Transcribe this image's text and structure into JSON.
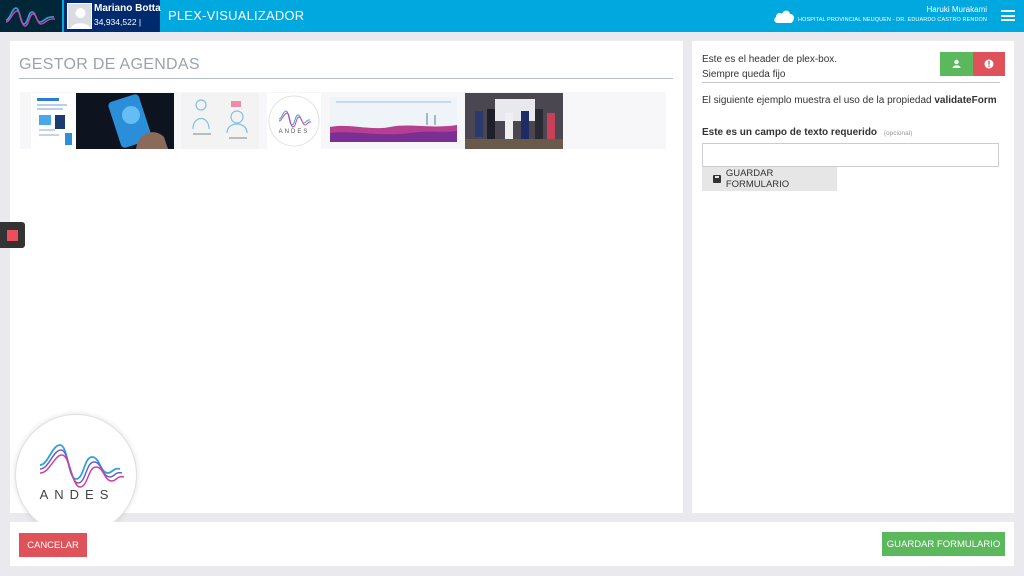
{
  "header": {
    "user_name": "Mariano Botta",
    "user_document": "34,934,522 |",
    "app_title": "PLEX-VISUALIZADOR",
    "right_user": "Haruki Murakami",
    "hospital": "HOSPITAL PROVINCIAL NEUQUEN - DR. EDUARDO CASTRO RENDON",
    "icons": [
      "andes-logo-icon",
      "avatar-icon",
      "cloud-icon",
      "menu-icon"
    ]
  },
  "main": {
    "section_title": "GESTOR DE AGENDAS",
    "gallery_logo_text": "ANDES",
    "big_logo_text": "ANDES"
  },
  "side_panel": {
    "header_line1": "Este es el header de plex-box.",
    "header_line2": "Siempre queda fijo",
    "example_text": "El siguiente ejemplo muestra el uso de la propiedad",
    "example_prop": "validateForm",
    "field_label": "Este es un campo de texto requerido",
    "field_optional": "(opcional)",
    "field_value": "",
    "save_label": "GUARDAR FORMULARIO"
  },
  "footer": {
    "cancel_label": "CANCELAR",
    "save_label": "GUARDAR FORMULARIO"
  },
  "colors": {
    "header": "#00a8e0",
    "user_box": "#002a6e",
    "success": "#5cb85c",
    "danger": "#e0525a"
  }
}
